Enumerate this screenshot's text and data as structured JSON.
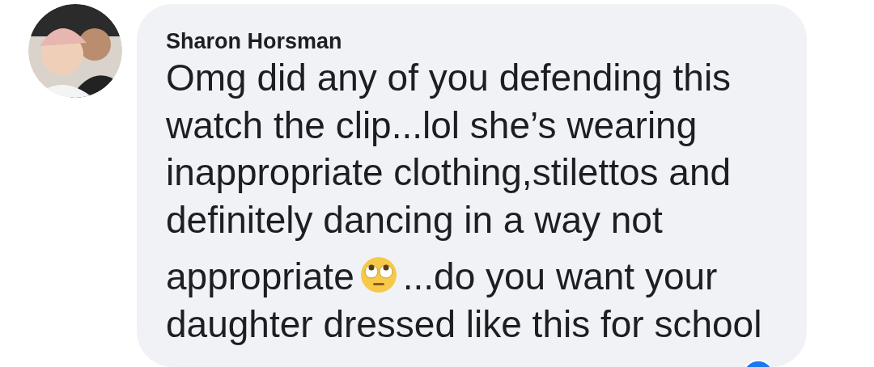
{
  "comment": {
    "author": "Sharon Horsman",
    "lines": [
      [
        "Omg did any of you defending this"
      ],
      [
        "watch the clip...lol she’s wearing"
      ],
      [
        "inappropriate clothing,stilettos and"
      ],
      [
        "definitely dancing in a way not"
      ],
      [
        "appropriate",
        "...do you want your"
      ],
      [
        "daughter dressed like this for school"
      ]
    ]
  }
}
